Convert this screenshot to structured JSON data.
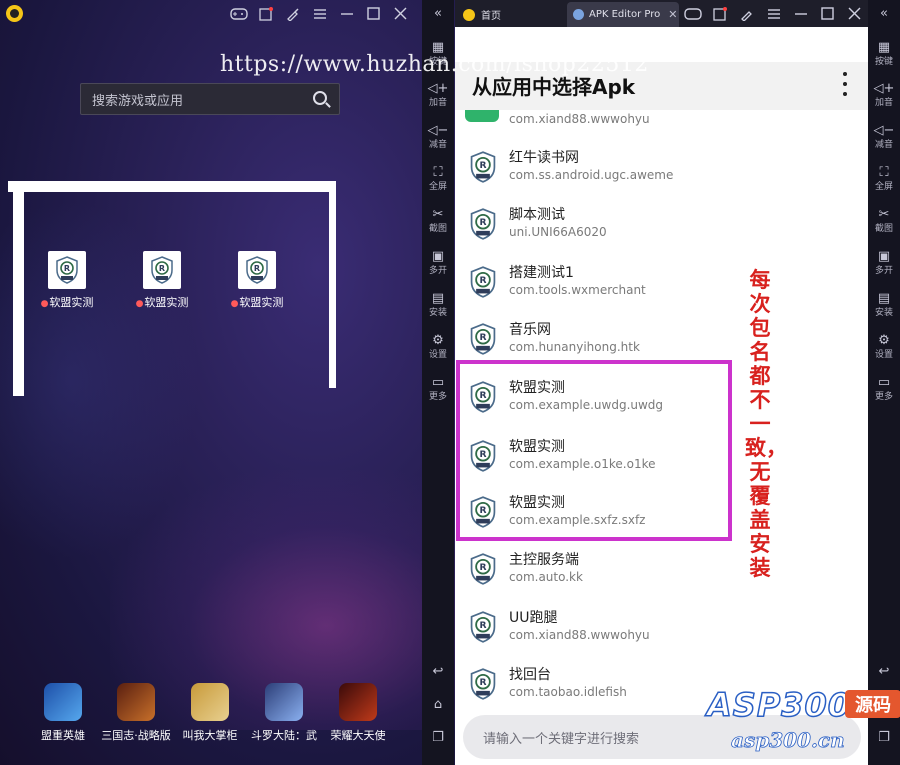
{
  "watermark_url": "https://www.huzhan.com/ishop22512",
  "left_window": {
    "search_placeholder": "搜索游戏或应用",
    "desktop_apps": [
      {
        "label": "软盟实测"
      },
      {
        "label": "软盟实测"
      },
      {
        "label": "软盟实测"
      }
    ],
    "dock_games": [
      {
        "label": "盟重英雄",
        "color": "#2a6fc9"
      },
      {
        "label": "三国志·战略版",
        "color": "#8a3a1c"
      },
      {
        "label": "叫我大掌柜",
        "color": "#c89a3a"
      },
      {
        "label": "斗罗大陆：武",
        "color": "#4a7ad0"
      },
      {
        "label": "荣耀大天使",
        "color": "#7a1c1c"
      }
    ]
  },
  "right_window": {
    "tabs": [
      {
        "label": "首页"
      },
      {
        "label": "APK Editor Pro"
      }
    ],
    "header_title": "从应用中选择Apk",
    "partial_package": "com.xiand88.wwwohyu",
    "apps": [
      {
        "name": "红牛读书网",
        "package": "com.ss.android.ugc.aweme"
      },
      {
        "name": "脚本测试",
        "package": "uni.UNI66A6020"
      },
      {
        "name": "搭建测试1",
        "package": "com.tools.wxmerchant"
      },
      {
        "name": "音乐网",
        "package": "com.hunanyihong.htk"
      },
      {
        "name": "软盟实测",
        "package": "com.example.uwdg.uwdg"
      },
      {
        "name": "软盟实测",
        "package": "com.example.o1ke.o1ke"
      },
      {
        "name": "软盟实测",
        "package": "com.example.sxfz.sxfz"
      },
      {
        "name": "主控服务端",
        "package": "com.auto.kk"
      },
      {
        "name": "UU跑腿",
        "package": "com.xiand88.wwwohyu"
      },
      {
        "name": "找回台",
        "package": "com.taobao.idlefish"
      }
    ],
    "search_placeholder": "请输入一个关键字进行搜索",
    "annotation": "每次包名都不一致，无覆盖安装"
  },
  "side_toolbar": [
    {
      "icon": "keyboard-icon",
      "label": "按键"
    },
    {
      "icon": "volume-up-icon",
      "label": "加音"
    },
    {
      "icon": "volume-down-icon",
      "label": "减音"
    },
    {
      "icon": "fullscreen-icon",
      "label": "全屏"
    },
    {
      "icon": "scissors-icon",
      "label": "截图"
    },
    {
      "icon": "multi-open-icon",
      "label": "多开"
    },
    {
      "icon": "apk-install-icon",
      "label": "安装"
    },
    {
      "icon": "gear-icon",
      "label": "设置"
    },
    {
      "icon": "more-icon",
      "label": "更多"
    }
  ],
  "brand": {
    "name": "ASP300",
    "tag": "源码",
    "domain": "asp300.cn"
  }
}
